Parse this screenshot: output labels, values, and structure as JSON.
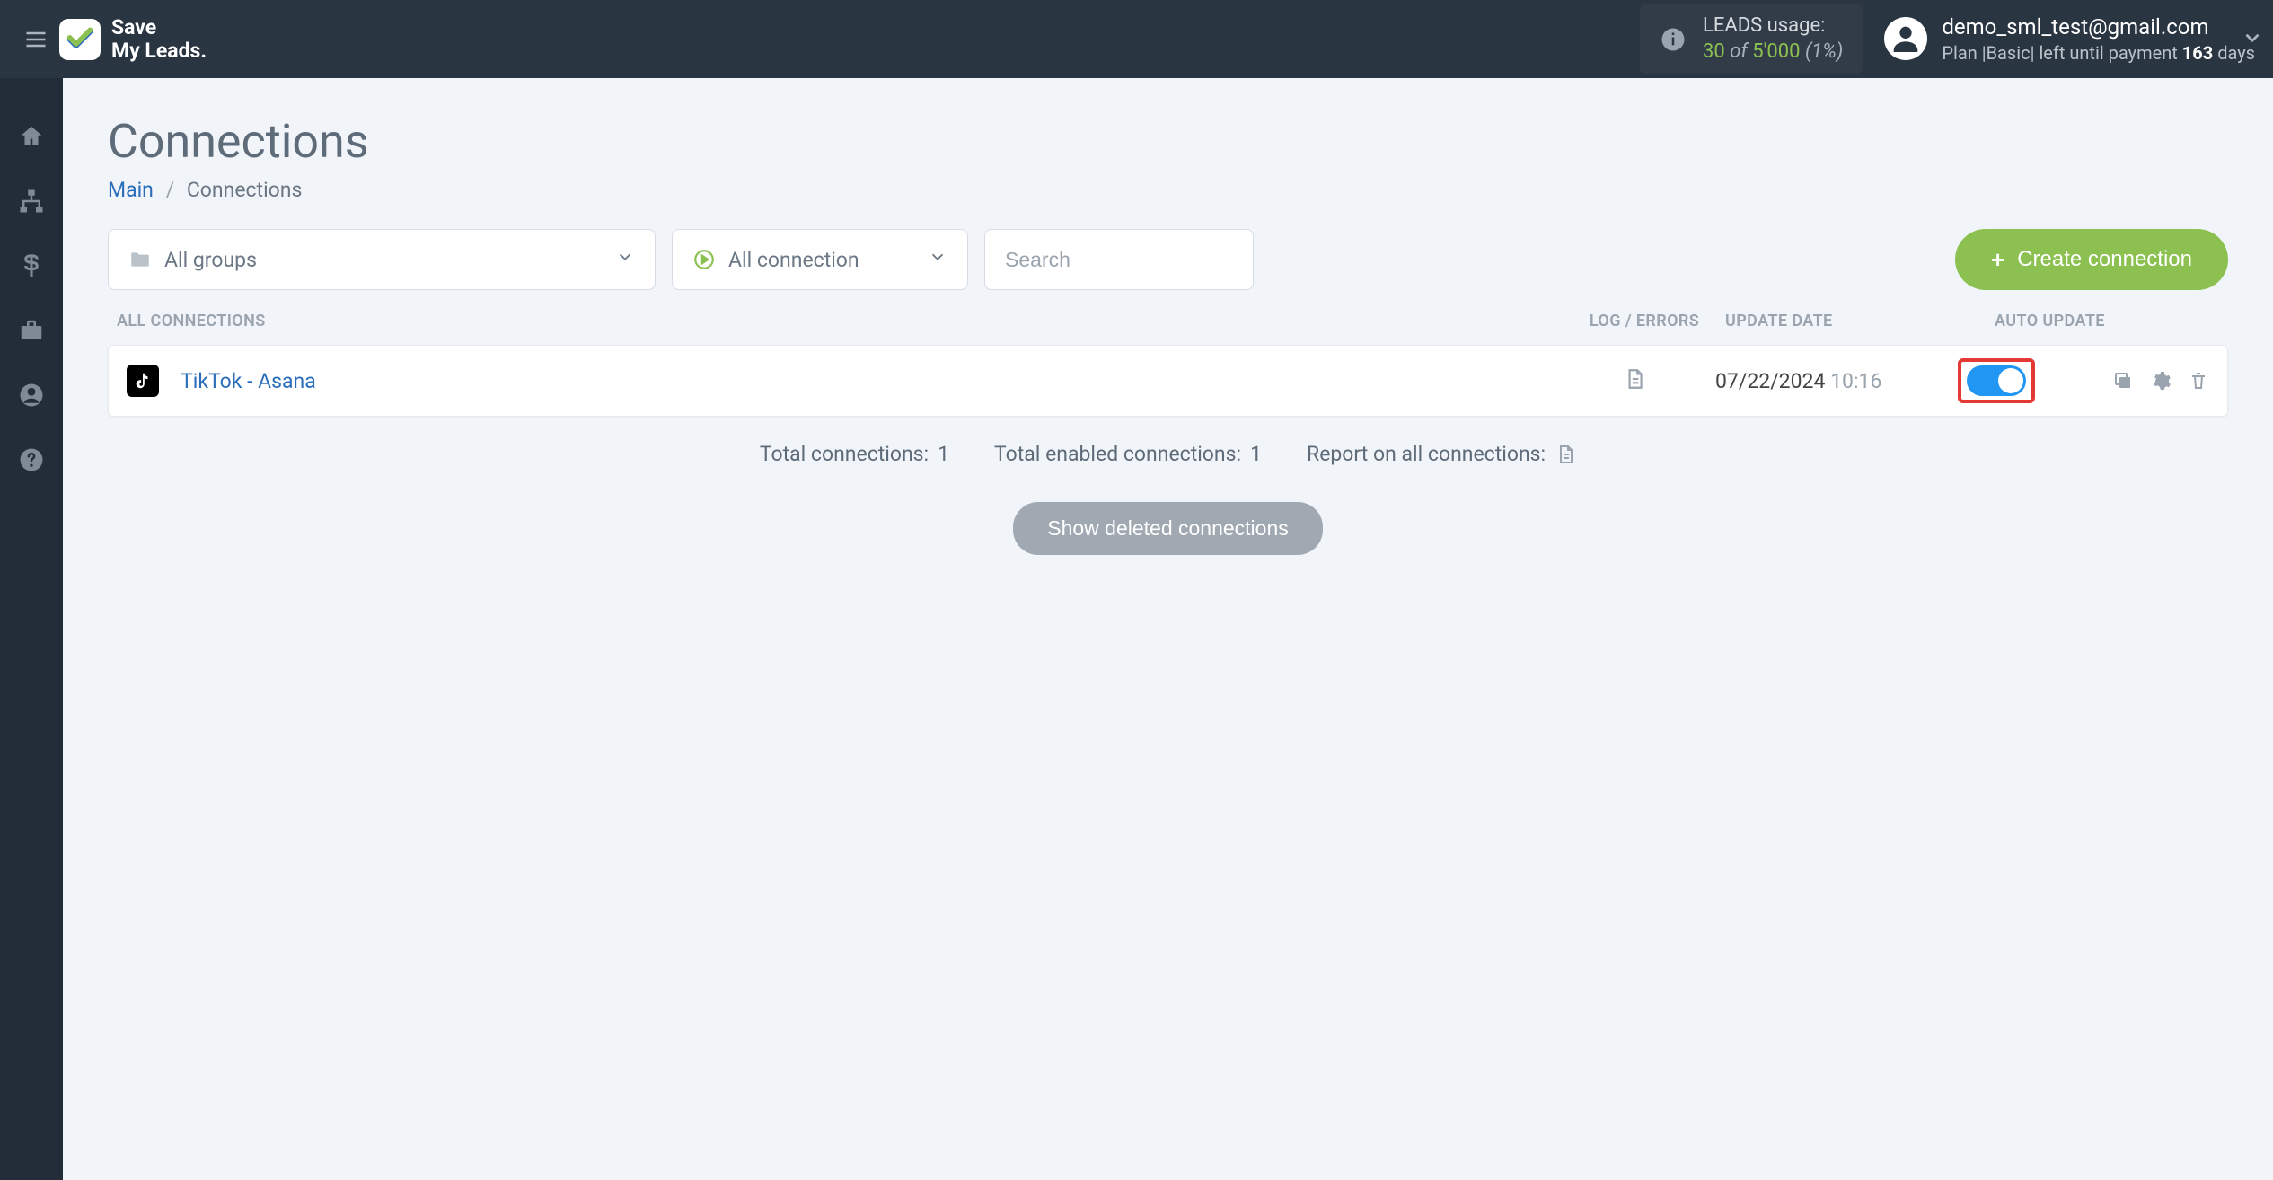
{
  "header": {
    "brand_line1": "Save",
    "brand_line2": "My Leads.",
    "leads_label": "LEADS usage:",
    "leads_current": "30",
    "leads_of": "of",
    "leads_total": "5'000",
    "leads_pct": "(1%)",
    "user_email": "demo_sml_test@gmail.com",
    "plan_prefix": "Plan |",
    "plan_name": "Basic",
    "plan_mid": "| left until payment ",
    "plan_days": "163",
    "plan_suffix": " days"
  },
  "page": {
    "title": "Connections",
    "breadcrumb_main": "Main",
    "breadcrumb_current": "Connections"
  },
  "filters": {
    "groups_label": "All groups",
    "status_label": "All connection",
    "search_placeholder": "Search",
    "create_btn": "Create connection"
  },
  "table": {
    "col_name": "ALL CONNECTIONS",
    "col_log": "LOG / ERRORS",
    "col_update": "UPDATE DATE",
    "col_auto": "AUTO UPDATE"
  },
  "rows": [
    {
      "name": "TikTok - Asana",
      "date": "07/22/2024",
      "time": "10:16"
    }
  ],
  "stats": {
    "total_conn_label": "Total connections: ",
    "total_conn_val": "1",
    "total_enabled_label": "Total enabled connections: ",
    "total_enabled_val": "1",
    "report_label": "Report on all connections:"
  },
  "show_deleted": "Show deleted connections"
}
